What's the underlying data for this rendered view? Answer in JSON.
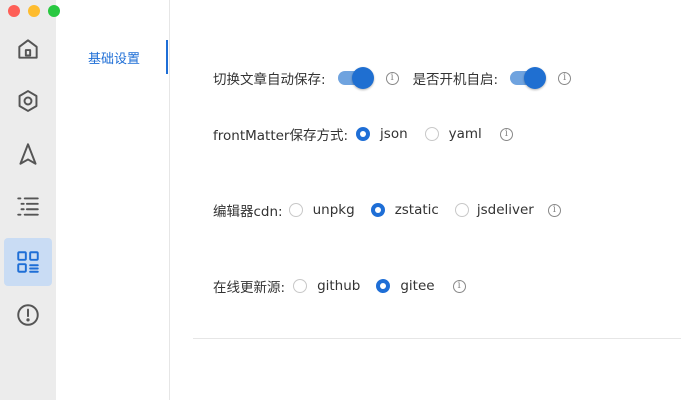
{
  "window": {
    "traffic_lights": {
      "close": "#fe5f57",
      "minimize": "#febc2e",
      "zoom": "#28c840"
    }
  },
  "rail": {
    "items": [
      {
        "icon": "home-icon"
      },
      {
        "icon": "gear-icon"
      },
      {
        "icon": "navigation-arrow-icon"
      },
      {
        "icon": "outline-list-icon"
      },
      {
        "icon": "grid-settings-icon",
        "active": true
      },
      {
        "icon": "info-circle-icon"
      }
    ]
  },
  "nav": {
    "items": [
      {
        "label": "基础设置",
        "active": true
      }
    ]
  },
  "settings": {
    "auto_save": {
      "label": "切换文章自动保存:",
      "enabled": true
    },
    "auto_start": {
      "label": "是否开机自启:",
      "enabled": true
    },
    "front_matter": {
      "label": "frontMatter保存方式:",
      "options": [
        "json",
        "yaml"
      ],
      "selected": "json"
    },
    "editor_cdn": {
      "label": "编辑器cdn:",
      "options": [
        "unpkg",
        "zstatic",
        "jsdeliver"
      ],
      "selected": "zstatic"
    },
    "update_source": {
      "label": "在线更新源:",
      "options": [
        "github",
        "gitee"
      ],
      "selected": "gitee"
    }
  },
  "colors": {
    "accent": "#1e6ed6",
    "rail_bg": "#ececec",
    "rail_active": "#c9dcf4"
  }
}
